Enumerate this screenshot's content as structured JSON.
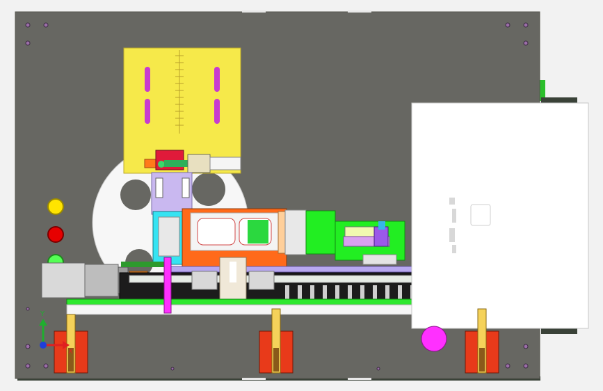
{
  "viewport": {
    "background": "#f2f2f2",
    "plate_color": "#676762",
    "shadow_color": "#3f4a3f"
  },
  "triad": {
    "y_label": "Y",
    "x_label": "X",
    "y_color": "#1fae2e",
    "x_color": "#e02020",
    "z_color": "#1f3fd8"
  },
  "components": [
    {
      "name": "mounting-plate",
      "color": "#676762"
    },
    {
      "name": "yellow-sliding-plate",
      "color": "#f6e94a"
    },
    {
      "name": "white-drum-wheel",
      "color": "#f7f7f7"
    },
    {
      "name": "indicator-light-yellow",
      "color": "#ffe400"
    },
    {
      "name": "indicator-light-red",
      "color": "#e60000"
    },
    {
      "name": "indicator-light-green",
      "color": "#55ff55"
    },
    {
      "name": "servo-motor",
      "color": "#c9c9c9"
    },
    {
      "name": "orange-clamp-carriage",
      "color": "#ff6a1a"
    },
    {
      "name": "green-sensor-board",
      "color": "#22ee22"
    },
    {
      "name": "magenta-support-posts",
      "color": "#ff30ff"
    },
    {
      "name": "white-cover-panel",
      "color": "#ffffff"
    },
    {
      "name": "red-foot-brackets",
      "color": "#e83a1a"
    },
    {
      "name": "linear-screw-rail",
      "color": "#1a1a1a"
    }
  ]
}
